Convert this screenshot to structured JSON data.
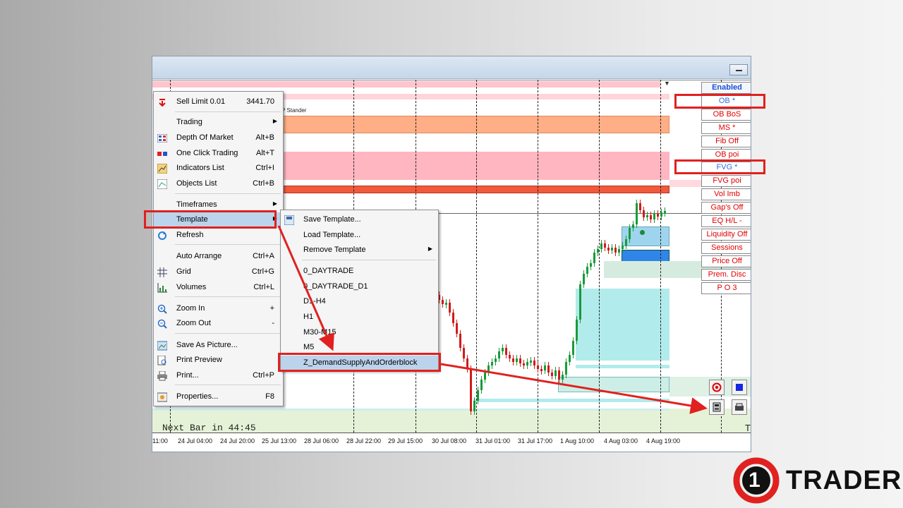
{
  "window": {
    "title": ""
  },
  "chart": {
    "label_stander": "P Stander",
    "next_bar": "Next Bar in 44:45",
    "right_mark": "T",
    "x_ticks": [
      "11:00",
      "24 Jul 04:00",
      "24 Jul 20:00",
      "25 Jul 13:00",
      "28 Jul 06:00",
      "28 Jul 22:00",
      "29 Jul 15:00",
      "30 Jul 08:00",
      "31 Jul 01:00",
      "31 Jul 17:00",
      "1 Aug 10:00",
      "4 Aug 03:00",
      "4 Aug 19:00"
    ]
  },
  "panel": {
    "buttons": [
      "Enabled",
      "OB *",
      "OB BoS",
      "MS *",
      "Fib Off",
      "OB poi",
      "FVG  *",
      "FVG poi",
      "Vol Imb",
      "Gap's Off",
      "EQ H/L  -",
      "Liquidity Off",
      "Sessions",
      "Price Off",
      "Prem. Disc",
      "P O 3"
    ],
    "icons": [
      "record-icon",
      "blue-square-icon",
      "calculator-icon",
      "printer-icon"
    ]
  },
  "context_menu": {
    "items": [
      {
        "label": "Sell Limit 0.01",
        "shortcut": "3441.70",
        "icon": "sell-arrow-icon"
      },
      {
        "label": "Trading",
        "submenu": true
      },
      {
        "label": "Depth Of Market",
        "shortcut": "Alt+B",
        "icon": "depth-icon"
      },
      {
        "label": "One Click Trading",
        "shortcut": "Alt+T",
        "icon": "one-click-icon"
      },
      {
        "label": "Indicators List",
        "shortcut": "Ctrl+I",
        "icon": "indicators-icon"
      },
      {
        "label": "Objects List",
        "shortcut": "Ctrl+B",
        "icon": "objects-icon"
      },
      {
        "label": "Timeframes",
        "submenu": true
      },
      {
        "label": "Template",
        "submenu": true
      },
      {
        "label": "Refresh",
        "icon": "refresh-icon"
      },
      {
        "label": "Auto Arrange",
        "shortcut": "Ctrl+A"
      },
      {
        "label": "Grid",
        "shortcut": "Ctrl+G",
        "icon": "grid-icon"
      },
      {
        "label": "Volumes",
        "shortcut": "Ctrl+L",
        "icon": "volumes-icon"
      },
      {
        "label": "Zoom In",
        "shortcut": "+",
        "icon": "zoom-in-icon"
      },
      {
        "label": "Zoom Out",
        "shortcut": "-",
        "icon": "zoom-out-icon"
      },
      {
        "label": "Save As Picture...",
        "icon": "picture-icon"
      },
      {
        "label": "Print Preview",
        "icon": "print-preview-icon"
      },
      {
        "label": "Print...",
        "shortcut": "Ctrl+P",
        "icon": "printer-icon"
      },
      {
        "label": "Properties...",
        "shortcut": "F8",
        "icon": "properties-icon"
      }
    ]
  },
  "template_menu": {
    "items": [
      "Save Template...",
      "Load Template...",
      "Remove Template",
      "0_DAYTRADE",
      "0_DAYTRADE_D1",
      "D1-H4",
      "H1",
      "M30-M15",
      "M5",
      "Z_DemandSupplyAndOrderblock"
    ]
  },
  "logo": {
    "number": "1",
    "text": "TRADER"
  },
  "colors": {
    "highlight_red": "#e0211f",
    "menu_highlight": "#bcd3ec",
    "ob_pink": "#ffb6c1",
    "fvg_cyan": "#b2ebeb"
  }
}
